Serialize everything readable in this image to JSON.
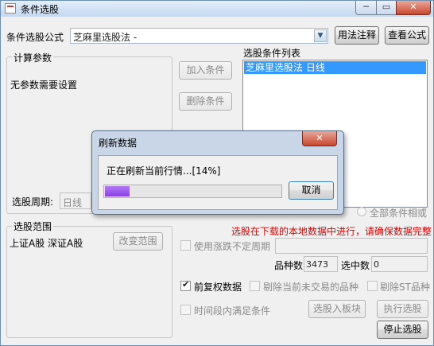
{
  "window": {
    "title": "条件选股",
    "min": "─",
    "max": "▭",
    "close": "✕"
  },
  "formula": {
    "label": "条件选股公式",
    "value": "芝麻里选股法 -",
    "help_button": "用法注释",
    "view_button": "查看公式"
  },
  "params": {
    "group_label": "计算参数",
    "no_params_text": "无参数需要设置"
  },
  "actions": {
    "add": "加入条件",
    "delete": "删除条件"
  },
  "conditions": {
    "label": "选股条件列表",
    "items": [
      "芝麻里选股法  日线"
    ]
  },
  "period": {
    "label": "选股周期:",
    "value": "日线"
  },
  "all_conditions_or": "全部条件相或",
  "range": {
    "group_label": "选股范围",
    "value": "上证A股 深证A股",
    "change_button": "改变范围"
  },
  "warning": "选股在下载的本地数据中进行，请确保数据完整",
  "options": {
    "variable_period": {
      "label": "使用涨跌不定周期",
      "checked": false,
      "enabled": false
    },
    "adjusted": {
      "label": "前复权数据",
      "checked": true
    },
    "exclude_untraded": {
      "label": "剔除当前未交易的品种",
      "checked": false
    },
    "exclude_st": {
      "label": "剔除ST品种",
      "checked": false
    },
    "time_range": {
      "label": "时间段内满足条件",
      "checked": false
    }
  },
  "stats": {
    "count_label": "品种数",
    "count_value": "3473",
    "selected_label": "选中数",
    "selected_value": "0"
  },
  "bottom_buttons": {
    "to_block": "选股入板块",
    "execute": "执行选股",
    "stop": "停止选股"
  },
  "dialog": {
    "title": "刷新数据",
    "message": "正在刷新当前行情...[14%]",
    "progress": 0.14,
    "cancel": "取消",
    "close": "✕"
  },
  "colors": {
    "warning": "#e00000",
    "progress_fill": "#8a3ee8",
    "selection": "#3399ff"
  }
}
